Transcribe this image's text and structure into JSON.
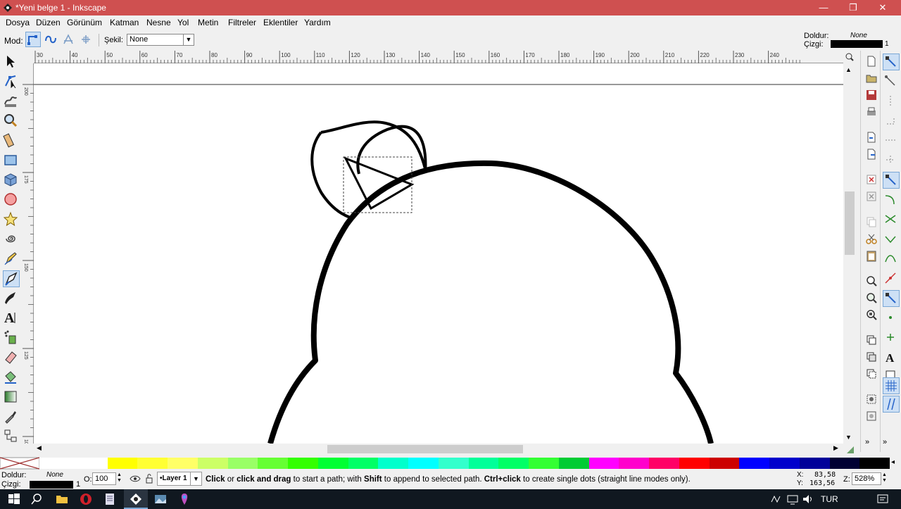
{
  "window": {
    "title": "*Yeni belge 1 - Inkscape",
    "minimize": "—",
    "maximize": "❐",
    "close": "✕"
  },
  "menu": [
    "Dosya",
    "Düzen",
    "Görünüm",
    "Katman",
    "Nesne",
    "Yol",
    "Metin",
    "Filtreler",
    "Eklentiler",
    "Yardım"
  ],
  "tool_controls": {
    "mode_label": "Mod:",
    "shape_label": "Şekil:",
    "shape_value": "None",
    "fill_label": "Doldur:",
    "fill_value": "None",
    "stroke_label": "Çizgi:",
    "stroke_width": "1"
  },
  "ruler": {
    "top_ticks": [
      "30",
      "40",
      "50",
      "60",
      "70",
      "80",
      "90",
      "100",
      "110",
      "120",
      "130",
      "140",
      "150",
      "160",
      "170",
      "180",
      "190",
      "200",
      "210",
      "220",
      "230",
      "240"
    ],
    "left_ticks": [
      "200",
      "175",
      "150",
      "125",
      "100"
    ]
  },
  "statusbar": {
    "fill_label": "Doldur:",
    "fill_value": "None",
    "stroke_label": "Çizgi:",
    "stroke_width": "1",
    "opacity_label": "O:",
    "opacity_value": "100",
    "layer_value": "•Layer 1",
    "message_parts": [
      {
        "t": "Click",
        "b": true
      },
      {
        "t": " or ",
        "b": false
      },
      {
        "t": "click and drag",
        "b": true
      },
      {
        "t": " to start a path; with ",
        "b": false
      },
      {
        "t": "Shift",
        "b": true
      },
      {
        "t": " to append to selected path. ",
        "b": false
      },
      {
        "t": "Ctrl+click",
        "b": true
      },
      {
        "t": " to create single dots (straight line modes only).",
        "b": false
      }
    ],
    "x_label": "X:",
    "x_value": "83,58",
    "y_label": "Y:",
    "y_value": "163,56",
    "zoom_label": "Z:",
    "zoom_value": "528%"
  },
  "taskbar": {
    "lang": "TUR"
  },
  "palette": [
    "#ffffff",
    "#ffff00",
    "#ffff33",
    "#ffff66",
    "#ccff66",
    "#99ff66",
    "#66ff33",
    "#33ff00",
    "#00ff33",
    "#00ff66",
    "#00ffcc",
    "#00ffff",
    "#33ffcc",
    "#00ff99",
    "#00ff66",
    "#33ff33",
    "#00cc33",
    "#ff00ff",
    "#ff00cc",
    "#ff0066",
    "#ff0000",
    "#cc0000",
    "#0000ff",
    "#0000cc",
    "#000099",
    "#000033",
    "#000000"
  ],
  "colors": {
    "titlebar": "#cf5050",
    "accent": "#7aa7d6"
  }
}
